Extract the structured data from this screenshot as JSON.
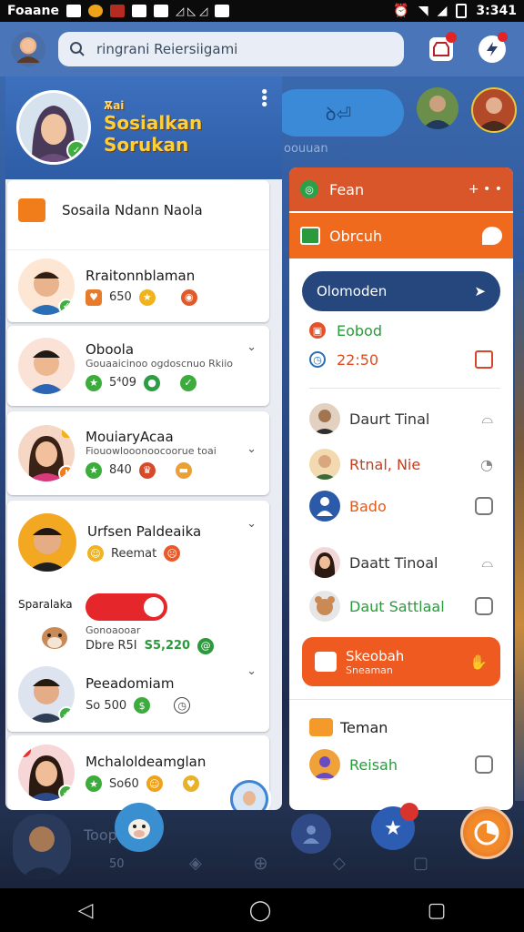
{
  "status_bar": {
    "carrier": "Foaane",
    "time": "3:341"
  },
  "top_bar": {
    "search_placeholder": "ringrani Reiersiigami"
  },
  "background": {
    "pill_text": "ꝺ⏎",
    "label": "oouuan"
  },
  "drawer": {
    "title_small": "Ѫai",
    "title_line1": "Sosialkan",
    "title_line2": "Sorukan",
    "section_title": "Sosaila Ndann Naola",
    "items": [
      {
        "name": "Rraitonnblaman",
        "sub": "",
        "stat": "650"
      },
      {
        "name": "Oboola",
        "sub": "Gouaaicinoo ogdoscnuo Rkiio",
        "stat": "5⁴09"
      },
      {
        "name": "MouiaryAcaa",
        "sub": "Fiouowlooonoocoorue toai",
        "stat": "840"
      },
      {
        "name": "Urfsen Paldeaika",
        "sub": "",
        "stat": "Reemat"
      },
      {
        "name": "Sparalaka",
        "sub": "Gonoaooar",
        "stat": "Dbre R5I",
        "stat2": "S5,220"
      },
      {
        "name": "Peeadomiam",
        "sub": "",
        "stat": "So 500"
      },
      {
        "name": "Mchaloldeamglan",
        "sub": "",
        "stat": "So60"
      }
    ]
  },
  "right_panel": {
    "header": "Fean",
    "subheader": "Obrcuh",
    "pill": "Olomoden",
    "event_name": "Eobod",
    "event_time": "22:50",
    "contacts": [
      "Daurt Tinal",
      "Rtnal, Nie",
      "Bado",
      "Daatt Tinoal",
      "Daut Sattlaal"
    ],
    "action_title": "Skeobah",
    "action_sub": "Sneaman",
    "group_title": "Teman",
    "group_item": "Reisah"
  },
  "bottom_bar": {
    "label": "Toop",
    "stat": "50"
  },
  "colors": {
    "accent_orange": "#f06a1e",
    "header_red": "#d9552a",
    "navy": "#26477d",
    "green": "#2b9a3c"
  }
}
